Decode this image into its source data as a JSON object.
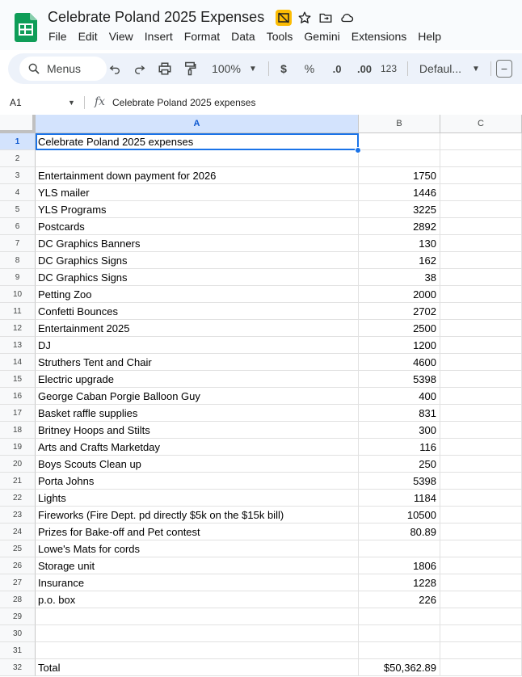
{
  "app": {
    "doc_title": "Celebrate Poland 2025 Expenses",
    "menu": [
      "File",
      "Edit",
      "View",
      "Insert",
      "Format",
      "Data",
      "Tools",
      "Gemini",
      "Extensions",
      "Help"
    ]
  },
  "toolbar": {
    "search_label": "Menus",
    "zoom": "100%",
    "currency": "$",
    "percent": "%",
    "dec_decrease": ".0",
    "dec_increase": ".00",
    "number_format": "123",
    "font": "Defaul...",
    "font_size_minus": "−"
  },
  "formula_bar": {
    "cell_ref": "A1",
    "fx": "fx",
    "value": "Celebrate Poland 2025 expenses"
  },
  "sheet": {
    "columns": [
      "A",
      "B",
      "C"
    ],
    "selected_cell": "A1",
    "rows": [
      {
        "num": "1",
        "a": "Celebrate Poland 2025 expenses",
        "b": ""
      },
      {
        "num": "2",
        "a": "",
        "b": ""
      },
      {
        "num": "3",
        "a": "Entertainment down payment for 2026",
        "b": "1750"
      },
      {
        "num": "4",
        "a": "YLS mailer",
        "b": "1446"
      },
      {
        "num": "5",
        "a": "YLS Programs",
        "b": "3225"
      },
      {
        "num": "6",
        "a": "Postcards",
        "b": "2892"
      },
      {
        "num": "7",
        "a": "DC Graphics Banners",
        "b": "130"
      },
      {
        "num": "8",
        "a": "DC Graphics Signs",
        "b": "162"
      },
      {
        "num": "9",
        "a": "DC Graphics  Signs",
        "b": "38"
      },
      {
        "num": "10",
        "a": "Petting Zoo",
        "b": "2000"
      },
      {
        "num": "11",
        "a": "Confetti Bounces",
        "b": "2702"
      },
      {
        "num": "12",
        "a": "Entertainment 2025",
        "b": "2500"
      },
      {
        "num": "13",
        "a": "DJ",
        "b": "1200"
      },
      {
        "num": "14",
        "a": "Struthers Tent and Chair",
        "b": "4600"
      },
      {
        "num": "15",
        "a": "Electric upgrade",
        "b": "5398"
      },
      {
        "num": "16",
        "a": "George Caban Porgie Balloon Guy",
        "b": "400"
      },
      {
        "num": "17",
        "a": "Basket raffle supplies",
        "b": "831"
      },
      {
        "num": "18",
        "a": "Britney Hoops and Stilts",
        "b": "300"
      },
      {
        "num": "19",
        "a": "Arts and Crafts Marketday",
        "b": "116"
      },
      {
        "num": "20",
        "a": "Boys Scouts Clean up",
        "b": "250"
      },
      {
        "num": "21",
        "a": "Porta Johns",
        "b": "5398"
      },
      {
        "num": "22",
        "a": "Lights",
        "b": "1184"
      },
      {
        "num": "23",
        "a": "Fireworks    (Fire Dept. pd directly $5k on the $15k bill)",
        "b": "10500"
      },
      {
        "num": "24",
        "a": "Prizes for Bake-off and Pet contest",
        "b": "80.89"
      },
      {
        "num": "25",
        "a": "Lowe's Mats for cords",
        "b": ""
      },
      {
        "num": "26",
        "a": "Storage unit",
        "b": "1806"
      },
      {
        "num": "27",
        "a": "Insurance",
        "b": "1228"
      },
      {
        "num": "28",
        "a": "p.o. box",
        "b": "226"
      },
      {
        "num": "29",
        "a": "",
        "b": ""
      },
      {
        "num": "30",
        "a": "",
        "b": ""
      },
      {
        "num": "31",
        "a": "",
        "b": ""
      },
      {
        "num": "32",
        "a": "Total",
        "b": "$50,362.89"
      }
    ]
  }
}
